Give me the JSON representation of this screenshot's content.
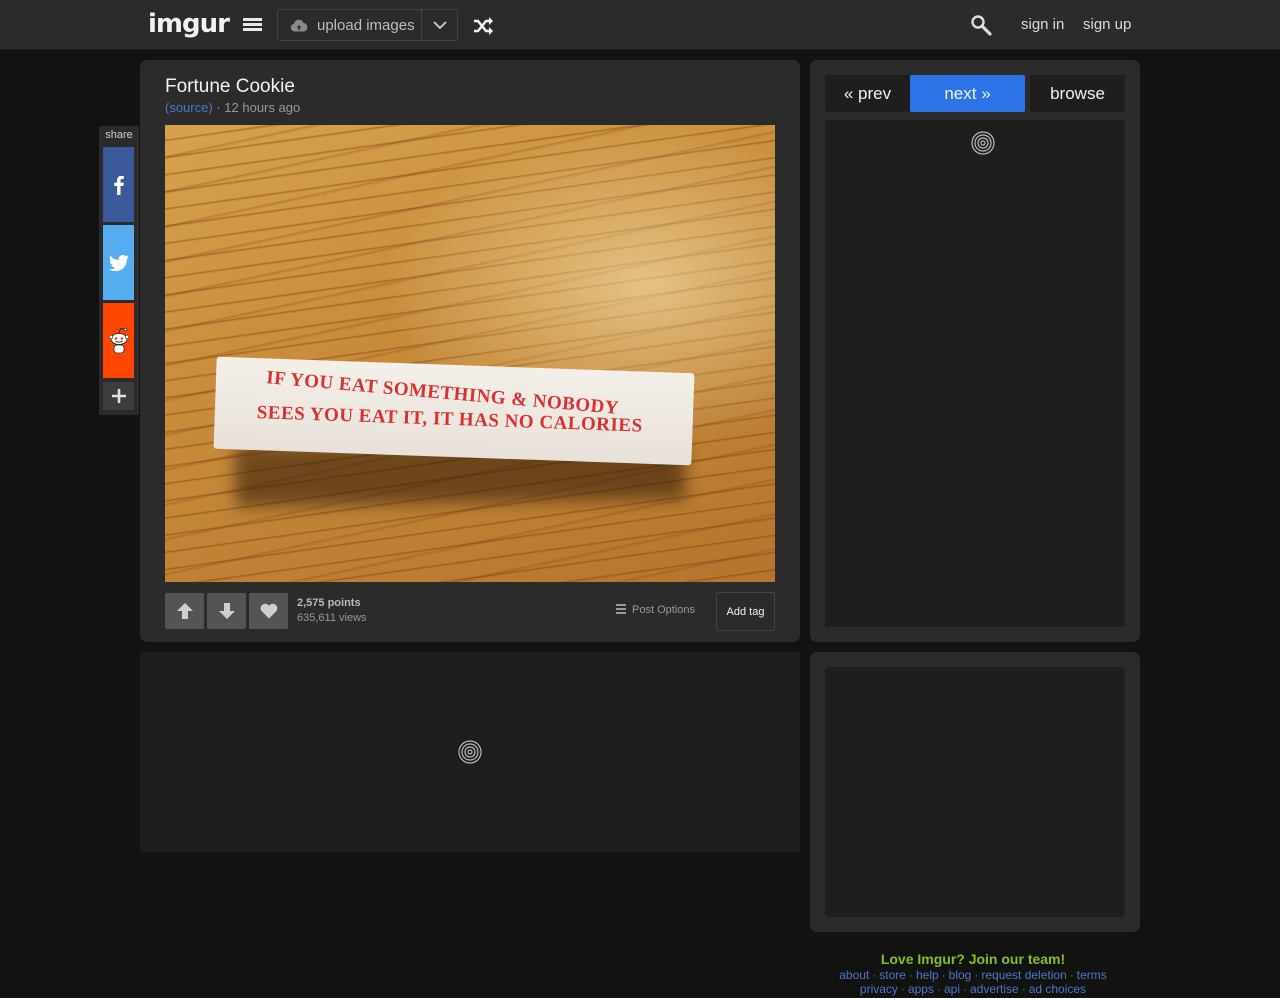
{
  "header": {
    "logo": "imgur",
    "upload_label": "upload images",
    "sign_in": "sign in",
    "sign_up": "sign up"
  },
  "share": {
    "label": "share",
    "buttons": [
      "facebook-icon",
      "twitter-icon",
      "reddit-icon",
      "plus-icon"
    ],
    "colors": {
      "facebook": "#3b5998",
      "twitter": "#55acee",
      "reddit": "#ff4500"
    }
  },
  "post": {
    "title": "Fortune Cookie",
    "source_link": "(source)",
    "separator": "·",
    "time_ago": "12 hours ago",
    "image_text_line1": "IF YOU EAT SOMETHING & NOBODY",
    "image_text_line2": "SEES YOU EAT IT, IT HAS NO CALORIES",
    "points": "2,575 points",
    "views": "635,611 views",
    "post_options": "Post Options",
    "add_tag": "Add tag"
  },
  "navigation": {
    "prev": "« prev",
    "next": "next »",
    "browse": "browse",
    "accent": "#2b73e6"
  },
  "footer": {
    "join": "Love Imgur? Join our team!",
    "links_row1": [
      "about",
      "store",
      "help",
      "blog",
      "request deletion",
      "terms"
    ],
    "links_row2": [
      "privacy",
      "apps",
      "api",
      "advertise",
      "ad choices"
    ],
    "join_color": "#85bf25",
    "link_color": "#4e76c9"
  }
}
